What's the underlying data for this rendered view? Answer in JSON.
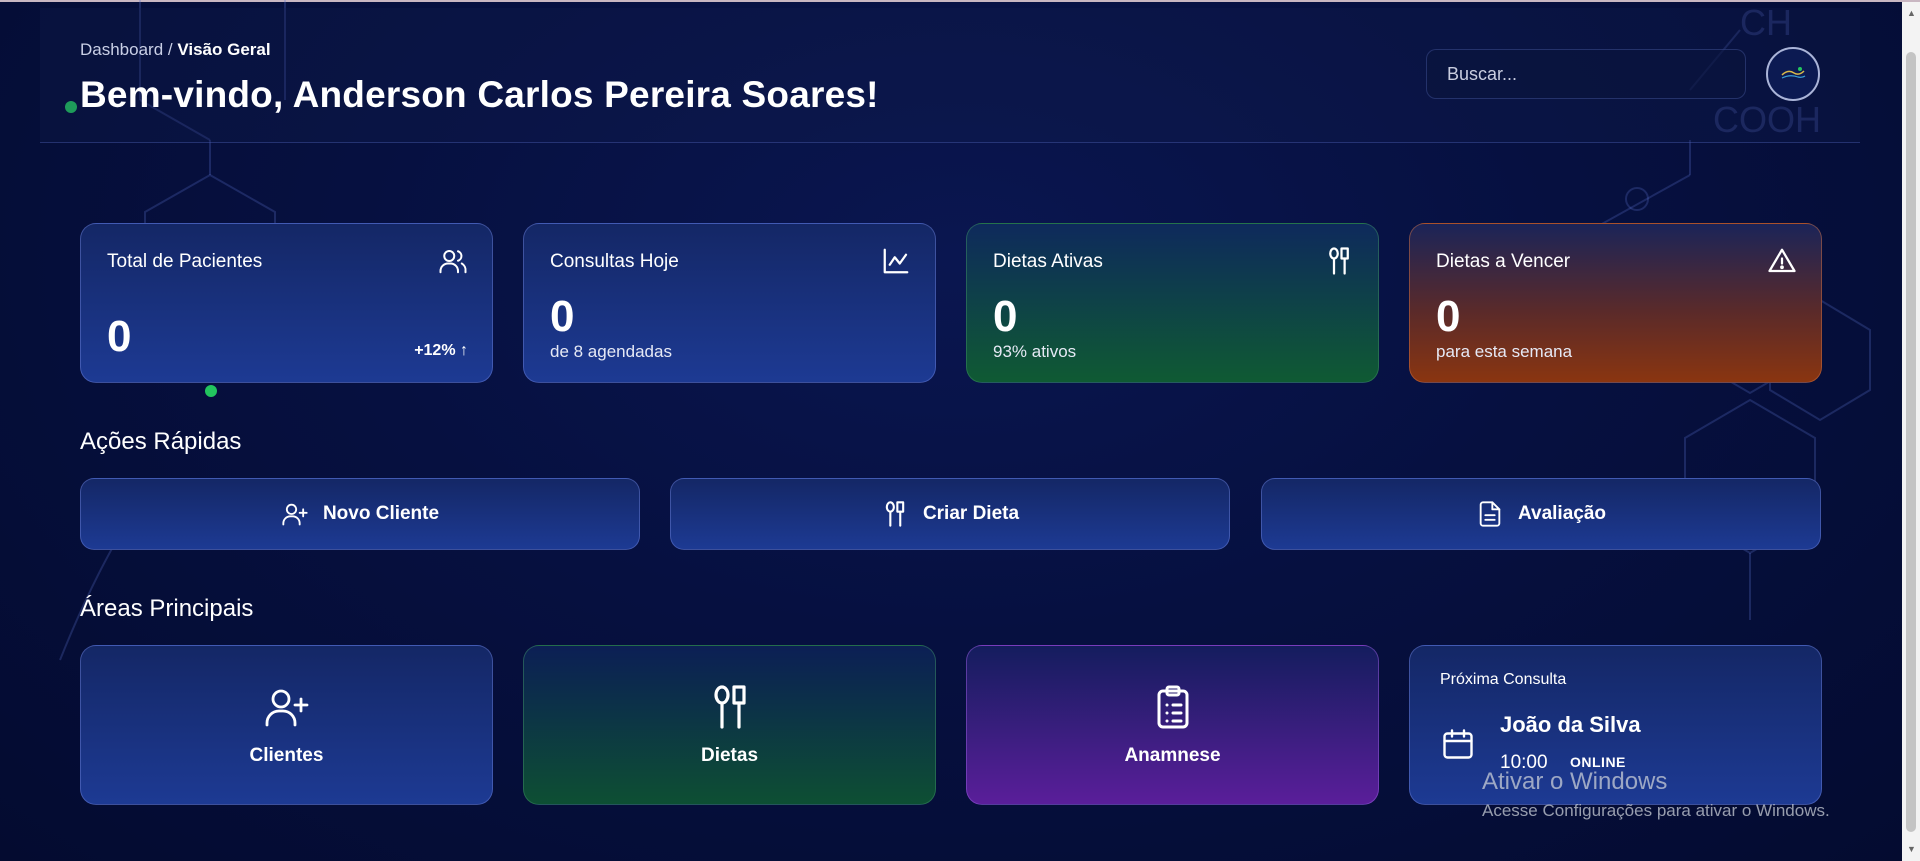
{
  "header": {
    "breadcrumb_root": "Dashboard",
    "breadcrumb_separator": " / ",
    "breadcrumb_current": "Visão Geral",
    "title": "Bem-vindo, Anderson Carlos Pereira Soares!",
    "search_placeholder": "Buscar..."
  },
  "stats": [
    {
      "label": "Total de Pacientes",
      "value": "0",
      "trend": "+12% ↑",
      "icon": "users-icon",
      "color": "#1d3a93"
    },
    {
      "label": "Consultas Hoje",
      "value": "0",
      "sub": "de 8 agendadas",
      "icon": "chart-line-icon",
      "color": "#1d3a93"
    },
    {
      "label": "Dietas Ativas",
      "value": "0",
      "sub": "93% ativos",
      "icon": "utensils-icon",
      "color": "#0f5a33"
    },
    {
      "label": "Dietas a Vencer",
      "value": "0",
      "sub": "para esta semana",
      "icon": "warning-icon",
      "color": "#8a3510"
    }
  ],
  "quick_actions": {
    "title": "Ações Rápidas",
    "items": [
      {
        "label": "Novo Cliente",
        "icon": "user-plus-icon"
      },
      {
        "label": "Criar Dieta",
        "icon": "utensils-icon"
      },
      {
        "label": "Avaliação",
        "icon": "file-text-icon"
      }
    ]
  },
  "areas": {
    "title": "Áreas Principais",
    "items": [
      {
        "label": "Clientes",
        "icon": "user-plus-icon"
      },
      {
        "label": "Dietas",
        "icon": "utensils-icon"
      },
      {
        "label": "Anamnese",
        "icon": "clipboard-list-icon"
      }
    ],
    "next_appointment": {
      "label": "Próxima Consulta",
      "patient": "João da Silva",
      "time": "10:00",
      "mode": "ONLINE",
      "icon": "calendar-icon"
    }
  },
  "overlay": {
    "windows_title": "Ativar o Windows",
    "windows_sub": "Acesse Configurações para ativar o Windows."
  },
  "colors": {
    "background": "#061040",
    "accent_green": "#22c55e",
    "card_blue": "#1d3a93",
    "card_purple": "#5a1e9a"
  }
}
